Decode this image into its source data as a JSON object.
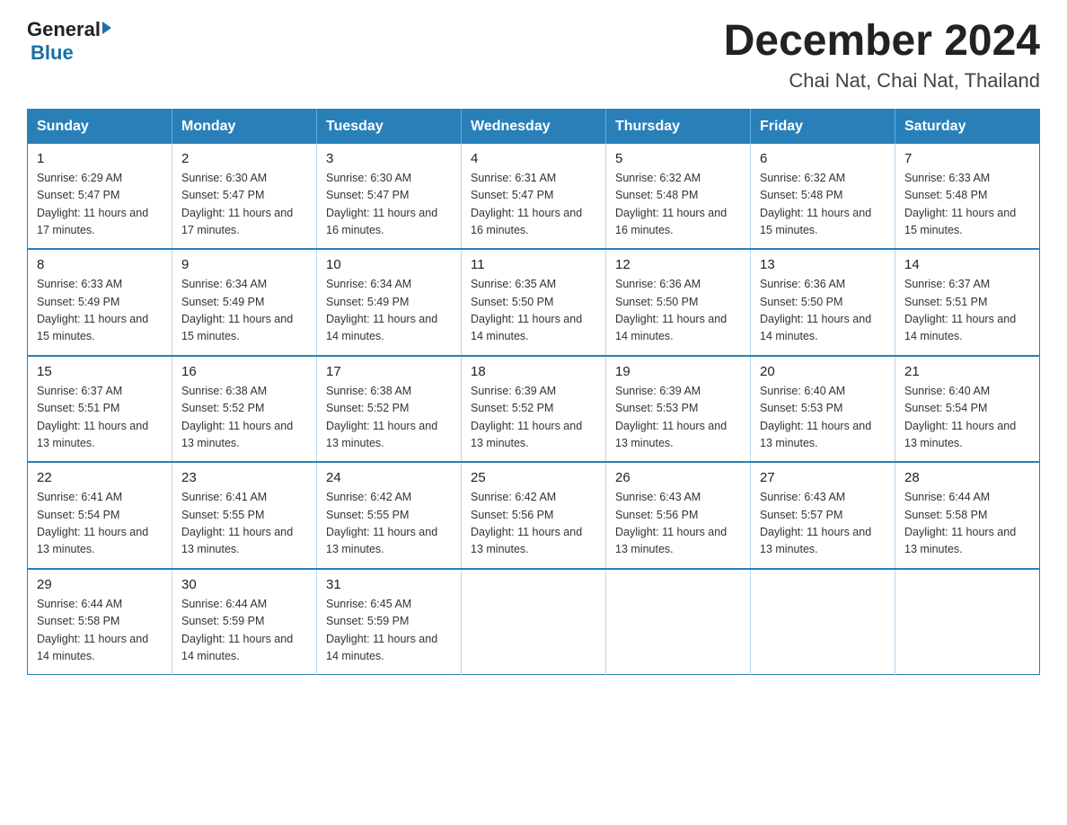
{
  "header": {
    "logo_general": "General",
    "logo_blue": "Blue",
    "title": "December 2024",
    "location": "Chai Nat, Chai Nat, Thailand"
  },
  "calendar": {
    "days_of_week": [
      "Sunday",
      "Monday",
      "Tuesday",
      "Wednesday",
      "Thursday",
      "Friday",
      "Saturday"
    ],
    "weeks": [
      [
        {
          "day": "1",
          "sunrise": "6:29 AM",
          "sunset": "5:47 PM",
          "daylight": "11 hours and 17 minutes."
        },
        {
          "day": "2",
          "sunrise": "6:30 AM",
          "sunset": "5:47 PM",
          "daylight": "11 hours and 17 minutes."
        },
        {
          "day": "3",
          "sunrise": "6:30 AM",
          "sunset": "5:47 PM",
          "daylight": "11 hours and 16 minutes."
        },
        {
          "day": "4",
          "sunrise": "6:31 AM",
          "sunset": "5:47 PM",
          "daylight": "11 hours and 16 minutes."
        },
        {
          "day": "5",
          "sunrise": "6:32 AM",
          "sunset": "5:48 PM",
          "daylight": "11 hours and 16 minutes."
        },
        {
          "day": "6",
          "sunrise": "6:32 AM",
          "sunset": "5:48 PM",
          "daylight": "11 hours and 15 minutes."
        },
        {
          "day": "7",
          "sunrise": "6:33 AM",
          "sunset": "5:48 PM",
          "daylight": "11 hours and 15 minutes."
        }
      ],
      [
        {
          "day": "8",
          "sunrise": "6:33 AM",
          "sunset": "5:49 PM",
          "daylight": "11 hours and 15 minutes."
        },
        {
          "day": "9",
          "sunrise": "6:34 AM",
          "sunset": "5:49 PM",
          "daylight": "11 hours and 15 minutes."
        },
        {
          "day": "10",
          "sunrise": "6:34 AM",
          "sunset": "5:49 PM",
          "daylight": "11 hours and 14 minutes."
        },
        {
          "day": "11",
          "sunrise": "6:35 AM",
          "sunset": "5:50 PM",
          "daylight": "11 hours and 14 minutes."
        },
        {
          "day": "12",
          "sunrise": "6:36 AM",
          "sunset": "5:50 PM",
          "daylight": "11 hours and 14 minutes."
        },
        {
          "day": "13",
          "sunrise": "6:36 AM",
          "sunset": "5:50 PM",
          "daylight": "11 hours and 14 minutes."
        },
        {
          "day": "14",
          "sunrise": "6:37 AM",
          "sunset": "5:51 PM",
          "daylight": "11 hours and 14 minutes."
        }
      ],
      [
        {
          "day": "15",
          "sunrise": "6:37 AM",
          "sunset": "5:51 PM",
          "daylight": "11 hours and 13 minutes."
        },
        {
          "day": "16",
          "sunrise": "6:38 AM",
          "sunset": "5:52 PM",
          "daylight": "11 hours and 13 minutes."
        },
        {
          "day": "17",
          "sunrise": "6:38 AM",
          "sunset": "5:52 PM",
          "daylight": "11 hours and 13 minutes."
        },
        {
          "day": "18",
          "sunrise": "6:39 AM",
          "sunset": "5:52 PM",
          "daylight": "11 hours and 13 minutes."
        },
        {
          "day": "19",
          "sunrise": "6:39 AM",
          "sunset": "5:53 PM",
          "daylight": "11 hours and 13 minutes."
        },
        {
          "day": "20",
          "sunrise": "6:40 AM",
          "sunset": "5:53 PM",
          "daylight": "11 hours and 13 minutes."
        },
        {
          "day": "21",
          "sunrise": "6:40 AM",
          "sunset": "5:54 PM",
          "daylight": "11 hours and 13 minutes."
        }
      ],
      [
        {
          "day": "22",
          "sunrise": "6:41 AM",
          "sunset": "5:54 PM",
          "daylight": "11 hours and 13 minutes."
        },
        {
          "day": "23",
          "sunrise": "6:41 AM",
          "sunset": "5:55 PM",
          "daylight": "11 hours and 13 minutes."
        },
        {
          "day": "24",
          "sunrise": "6:42 AM",
          "sunset": "5:55 PM",
          "daylight": "11 hours and 13 minutes."
        },
        {
          "day": "25",
          "sunrise": "6:42 AM",
          "sunset": "5:56 PM",
          "daylight": "11 hours and 13 minutes."
        },
        {
          "day": "26",
          "sunrise": "6:43 AM",
          "sunset": "5:56 PM",
          "daylight": "11 hours and 13 minutes."
        },
        {
          "day": "27",
          "sunrise": "6:43 AM",
          "sunset": "5:57 PM",
          "daylight": "11 hours and 13 minutes."
        },
        {
          "day": "28",
          "sunrise": "6:44 AM",
          "sunset": "5:58 PM",
          "daylight": "11 hours and 13 minutes."
        }
      ],
      [
        {
          "day": "29",
          "sunrise": "6:44 AM",
          "sunset": "5:58 PM",
          "daylight": "11 hours and 14 minutes."
        },
        {
          "day": "30",
          "sunrise": "6:44 AM",
          "sunset": "5:59 PM",
          "daylight": "11 hours and 14 minutes."
        },
        {
          "day": "31",
          "sunrise": "6:45 AM",
          "sunset": "5:59 PM",
          "daylight": "11 hours and 14 minutes."
        },
        null,
        null,
        null,
        null
      ]
    ]
  }
}
